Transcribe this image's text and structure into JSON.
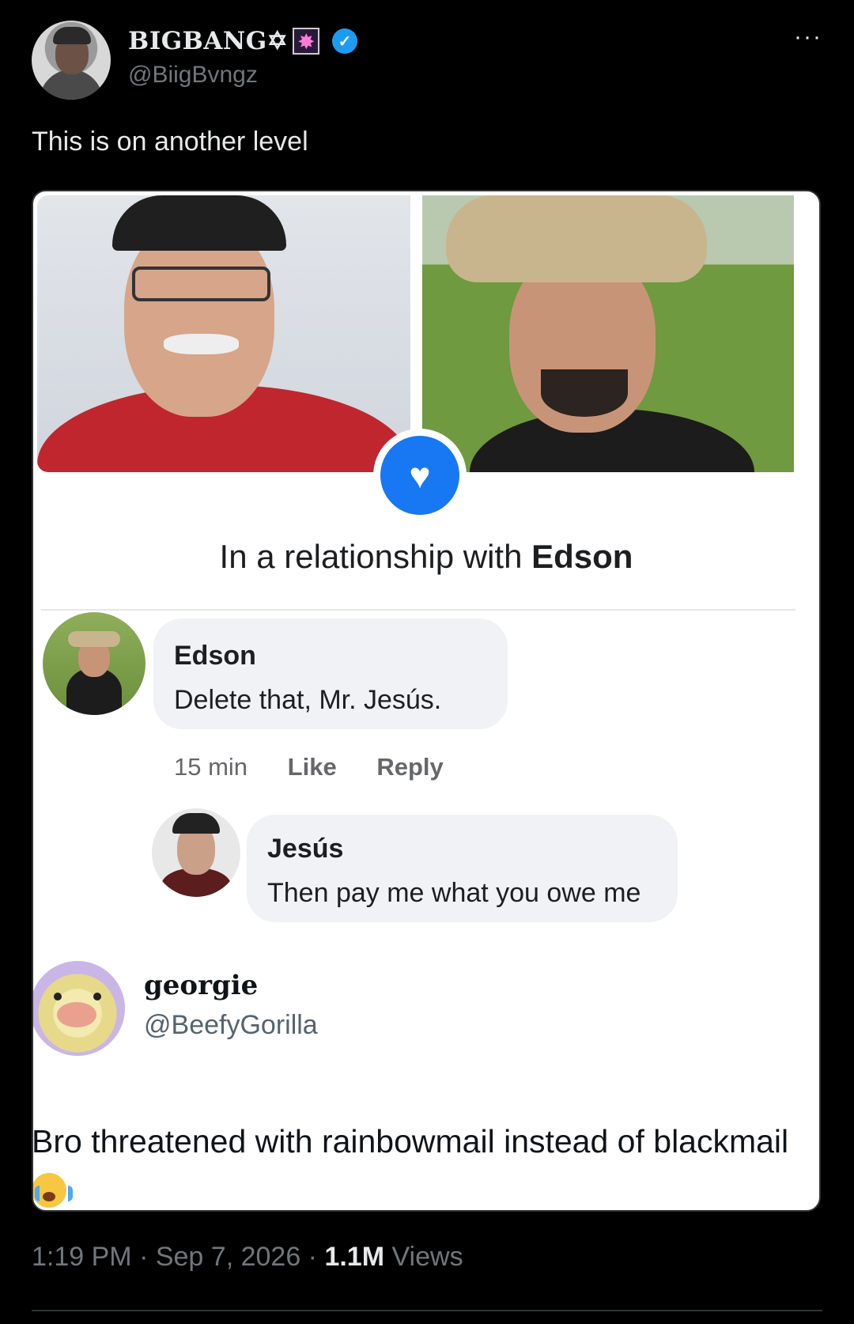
{
  "author": {
    "display_name": "BIGBANG✡",
    "handle": "@BiigBvngz",
    "more_label": "···"
  },
  "tweet": {
    "text": "This is on another level"
  },
  "embedded_post": {
    "relationship_prefix": "In a relationship with ",
    "relationship_name": "Edson",
    "comments": [
      {
        "name": "Edson",
        "text": "Delete that, Mr. Jesús.",
        "time": "15 min",
        "like_label": "Like",
        "reply_label": "Reply"
      },
      {
        "name": "Jesús",
        "text": "Then pay me what you owe me"
      }
    ]
  },
  "quoted": {
    "display_name": "georgie",
    "handle": "@BeefyGorilla",
    "text": "Bro threatened with rainbowmail instead of blackmail"
  },
  "footer": {
    "time": "1:19 PM",
    "sep1": " · ",
    "date": "Sep 7, 2026",
    "sep2": " · ",
    "views_count": "1.1M",
    "views_label": " Views"
  },
  "colors": {
    "background": "#000000",
    "accent_blue": "#1877f2",
    "verified_blue": "#1d9bf0",
    "muted_text": "#71767b"
  }
}
